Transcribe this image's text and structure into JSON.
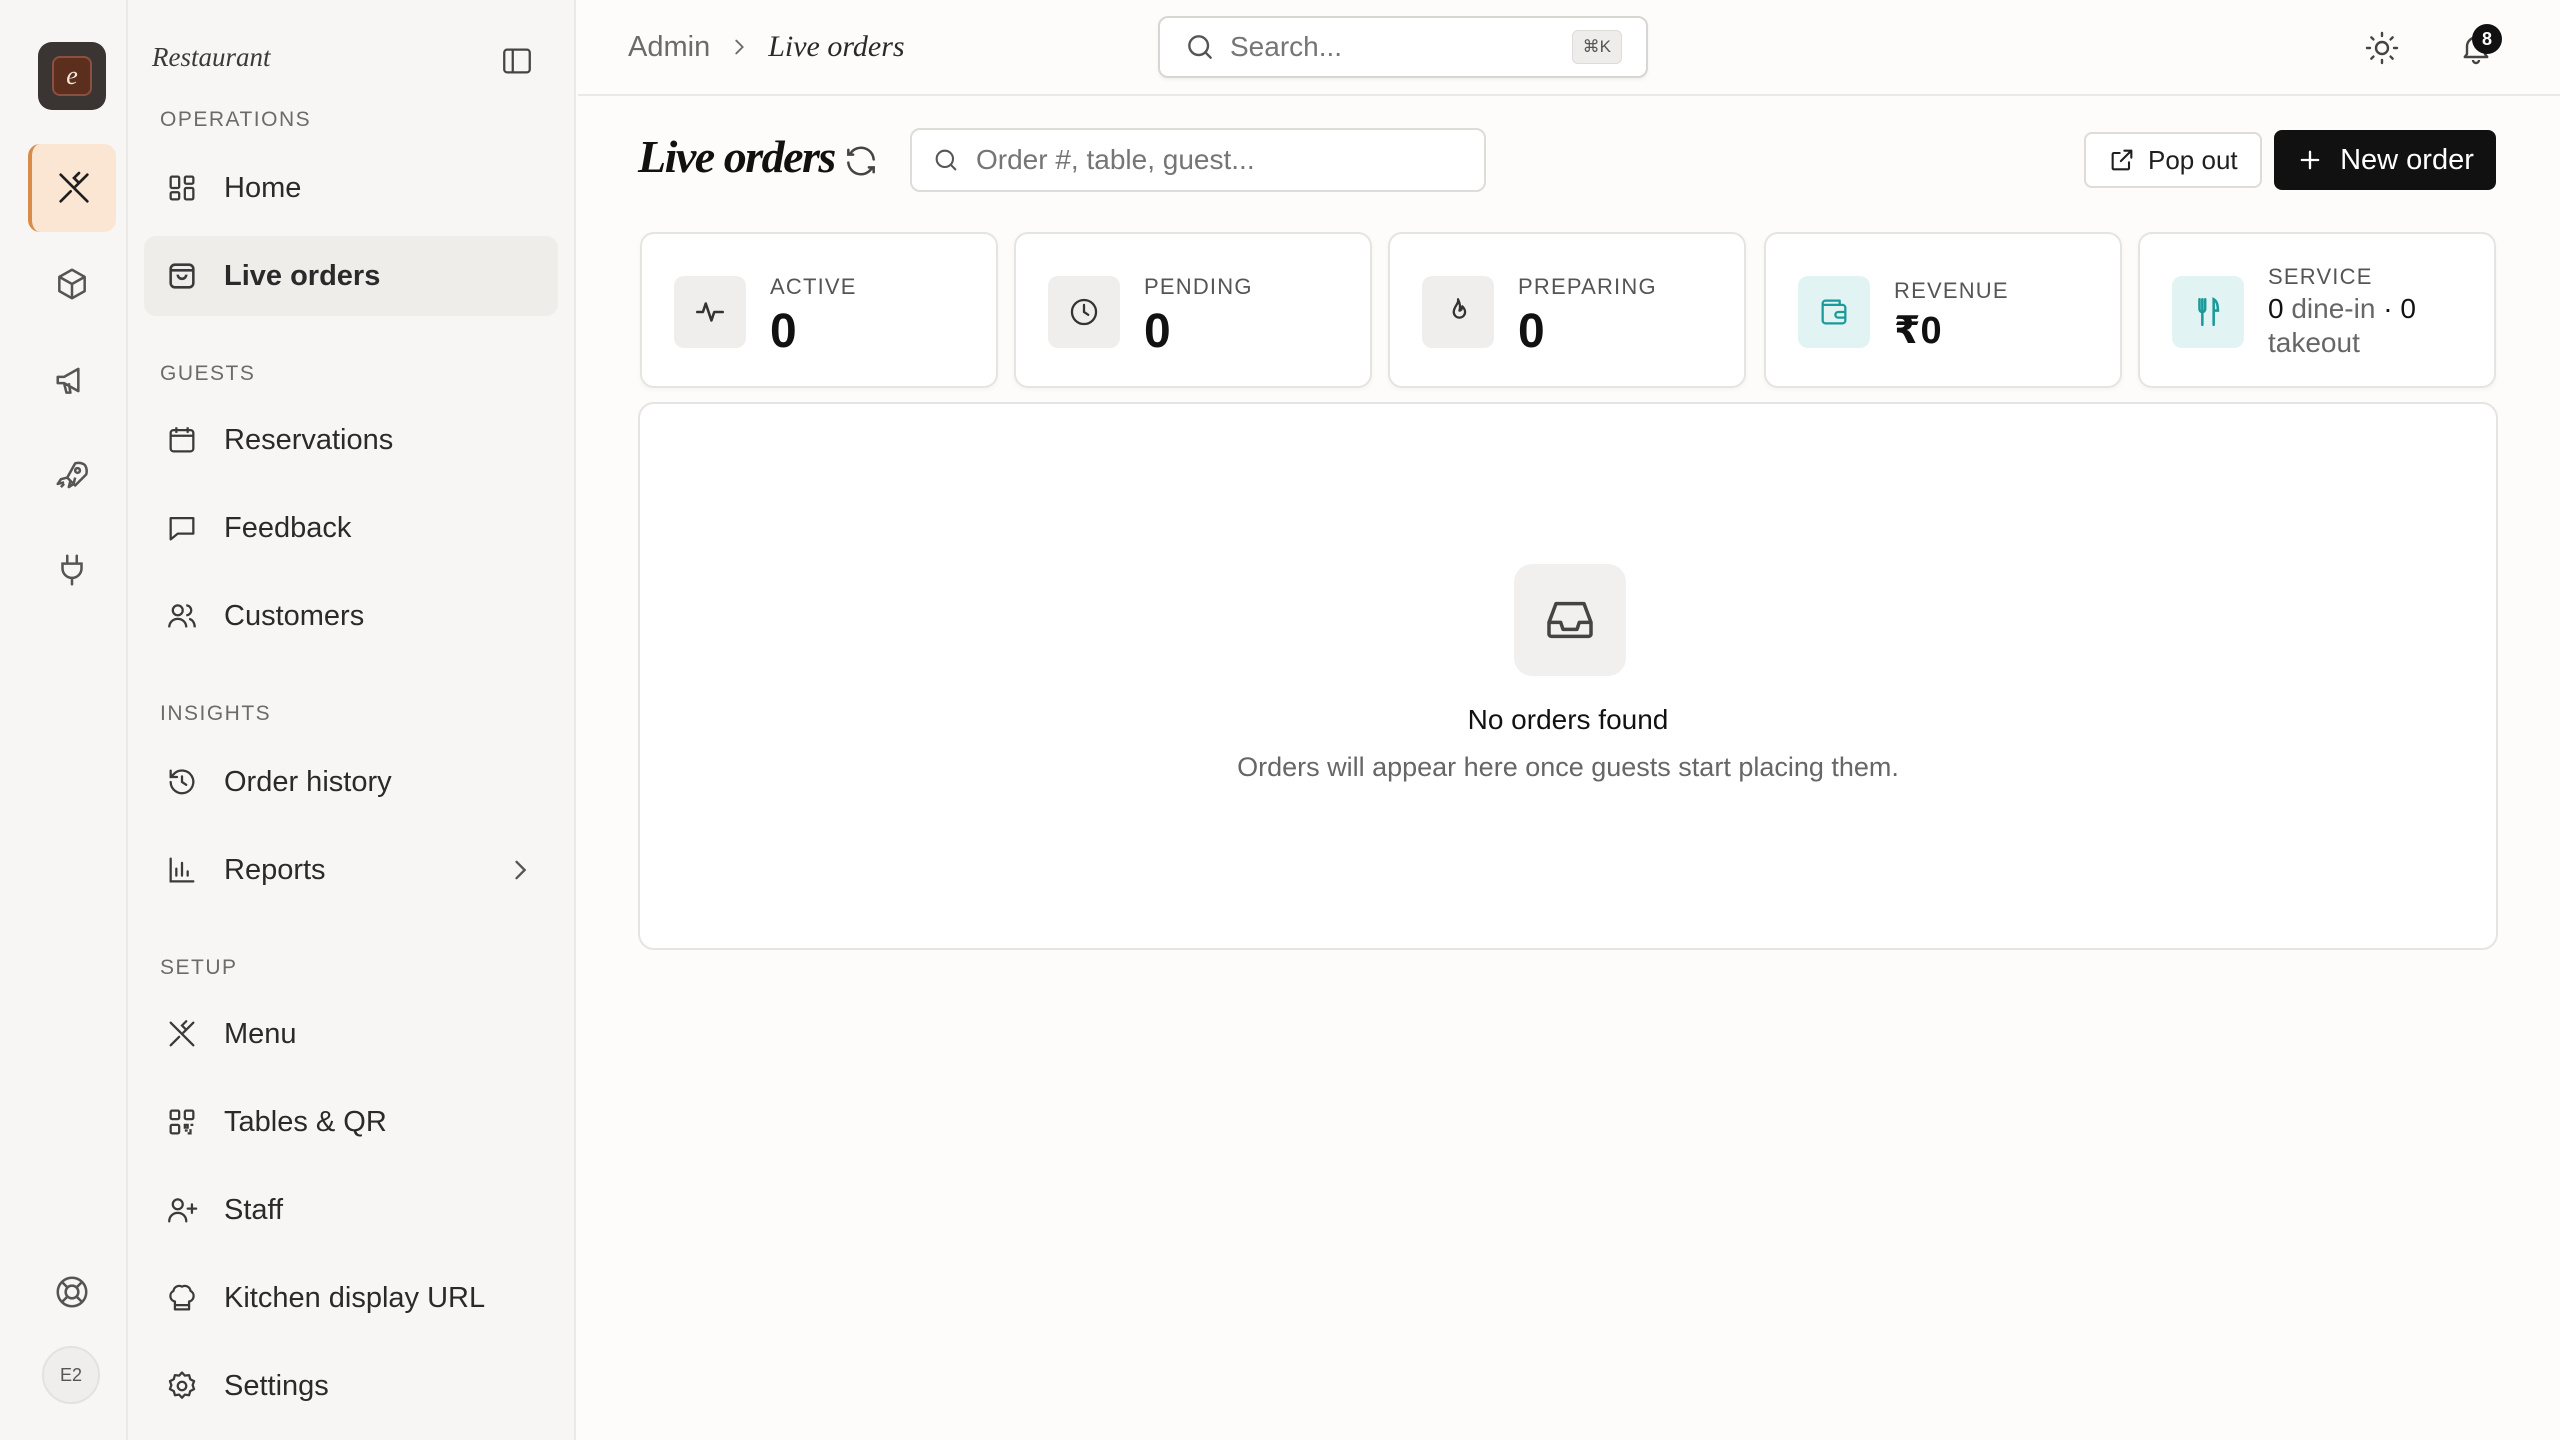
{
  "rail": {
    "avatar_initials": "E2",
    "logo_letter": "e",
    "icons": [
      "utensils-icon",
      "box-icon",
      "megaphone-icon",
      "rocket-icon",
      "plug-icon",
      "life-buoy-icon"
    ]
  },
  "sidebar": {
    "title": "Restaurant",
    "sections": {
      "operations": "OPERATIONS",
      "guests": "GUESTS",
      "insights": "INSIGHTS",
      "setup": "SETUP"
    },
    "items": {
      "home": "Home",
      "live_orders": "Live orders",
      "reservations": "Reservations",
      "feedback": "Feedback",
      "customers": "Customers",
      "order_history": "Order history",
      "reports": "Reports",
      "menu": "Menu",
      "tables_qr": "Tables & QR",
      "staff": "Staff",
      "kitchen_display": "Kitchen display URL",
      "settings": "Settings"
    }
  },
  "topbar": {
    "breadcrumb_root": "Admin",
    "breadcrumb_current": "Live orders",
    "search_placeholder": "Search...",
    "search_shortcut": "⌘K",
    "notification_count": "8"
  },
  "header": {
    "title": "Live orders",
    "order_search_placeholder": "Order #, table, guest...",
    "popout_label": "Pop out",
    "new_order_label": "New order"
  },
  "stats": {
    "active": {
      "label": "ACTIVE",
      "value": "0"
    },
    "pending": {
      "label": "PENDING",
      "value": "0"
    },
    "preparing": {
      "label": "PREPARING",
      "value": "0"
    },
    "revenue": {
      "label": "REVENUE",
      "value": "₹0"
    },
    "service": {
      "label": "SERVICE",
      "dine_in": "0",
      "dine_in_label": "dine-in",
      "sep": "·",
      "takeout": "0",
      "takeout_label": "takeout"
    }
  },
  "empty_state": {
    "title": "No orders found",
    "subtitle": "Orders will appear here once guests start placing them."
  },
  "colors": {
    "accent_active_bg": "#fbe6d3",
    "accent_active_border": "#d98b4a",
    "teal": "#1a9a9a",
    "primary_button": "#111111"
  }
}
